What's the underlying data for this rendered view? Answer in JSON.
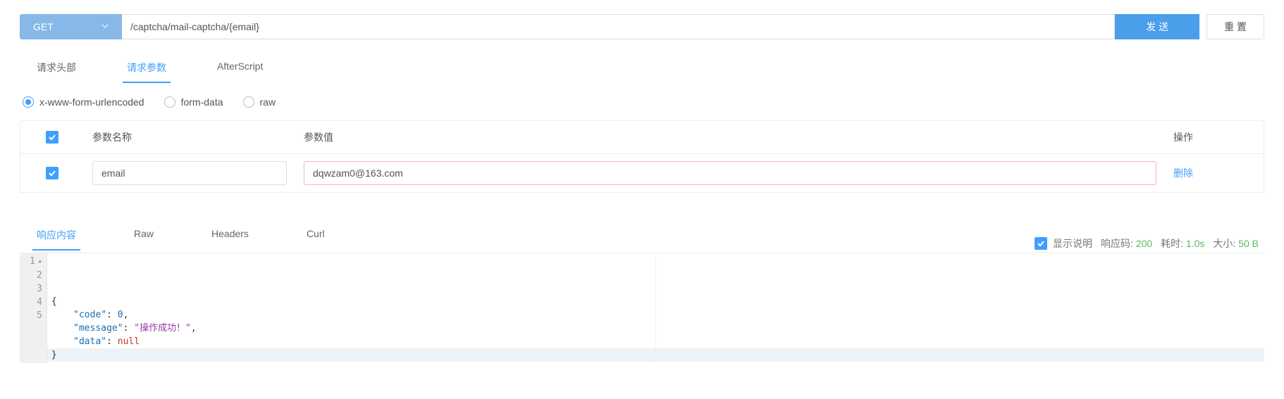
{
  "request": {
    "method": "GET",
    "url": "/captcha/mail-captcha/{email}",
    "send_label": "发 送",
    "reset_label": "重 置"
  },
  "request_tabs": {
    "headers": "请求头部",
    "params": "请求参数",
    "afterscript": "AfterScript",
    "active": "params"
  },
  "body_type": {
    "urlencoded": "x-www-form-urlencoded",
    "formdata": "form-data",
    "raw": "raw",
    "selected": "urlencoded"
  },
  "params_table": {
    "header_name": "参数名称",
    "header_value": "参数值",
    "header_action": "操作",
    "delete_label": "删除",
    "rows": [
      {
        "enabled": true,
        "name": "email",
        "value": "dqwzam0@163.com"
      }
    ]
  },
  "response_tabs": {
    "content": "响应内容",
    "raw": "Raw",
    "headers": "Headers",
    "curl": "Curl",
    "active": "content"
  },
  "response_meta": {
    "show_desc_label": "显示说明",
    "show_desc_checked": true,
    "code_label": "响应码:",
    "code_value": "200",
    "time_label": "耗时:",
    "time_value": "1.0s",
    "size_label": "大小:",
    "size_value": "50 B"
  },
  "response_body": {
    "lines": [
      {
        "n": 1,
        "fold": true,
        "tokens": [
          {
            "t": "brace",
            "v": "{"
          }
        ]
      },
      {
        "n": 2,
        "tokens": [
          {
            "t": "indent",
            "v": "    "
          },
          {
            "t": "key",
            "v": "\"code\""
          },
          {
            "t": "plain",
            "v": ": "
          },
          {
            "t": "num",
            "v": "0"
          },
          {
            "t": "plain",
            "v": ","
          }
        ]
      },
      {
        "n": 3,
        "tokens": [
          {
            "t": "indent",
            "v": "    "
          },
          {
            "t": "key",
            "v": "\"message\""
          },
          {
            "t": "plain",
            "v": ": "
          },
          {
            "t": "str",
            "v": "\"操作成功！\""
          },
          {
            "t": "plain",
            "v": ","
          }
        ]
      },
      {
        "n": 4,
        "tokens": [
          {
            "t": "indent",
            "v": "    "
          },
          {
            "t": "key",
            "v": "\"data\""
          },
          {
            "t": "plain",
            "v": ": "
          },
          {
            "t": "null",
            "v": "null"
          }
        ]
      },
      {
        "n": 5,
        "hl": true,
        "tokens": [
          {
            "t": "brace",
            "v": "}"
          }
        ]
      }
    ]
  }
}
